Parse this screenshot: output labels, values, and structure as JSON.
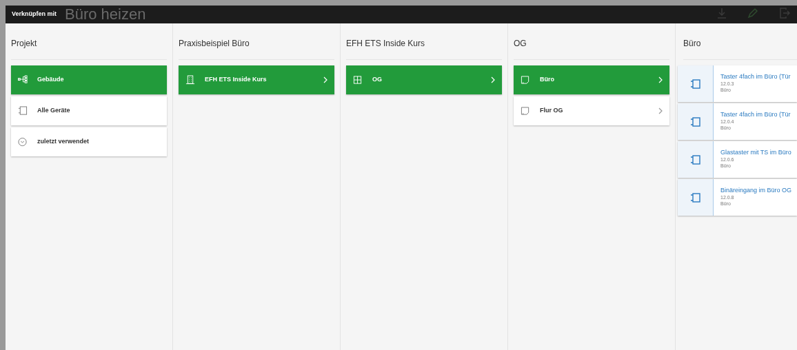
{
  "background": {
    "title": "Büro heizen"
  },
  "dialog": {
    "title": "Verknüpfen mit"
  },
  "columns": [
    {
      "title": "Projekt",
      "items": [
        {
          "label": "Gebäude",
          "kind": "tree",
          "selected": true,
          "expandable": false
        },
        {
          "label": "Alle Geräte",
          "kind": "device",
          "selected": false,
          "expandable": false
        },
        {
          "label": "zuletzt verwendet",
          "kind": "clock",
          "selected": false,
          "expandable": false
        }
      ]
    },
    {
      "title": "Praxisbeispiel Büro",
      "items": [
        {
          "label": "EFH ETS Inside Kurs",
          "kind": "building",
          "selected": true,
          "expandable": true
        }
      ]
    },
    {
      "title": "EFH ETS Inside Kurs",
      "items": [
        {
          "label": "OG",
          "kind": "floor",
          "selected": true,
          "expandable": true
        }
      ]
    },
    {
      "title": "OG",
      "items": [
        {
          "label": "Büro",
          "kind": "room",
          "selected": true,
          "expandable": true
        },
        {
          "label": "Flur OG",
          "kind": "room",
          "selected": false,
          "expandable": true
        }
      ]
    }
  ],
  "devices_column": {
    "title": "Büro",
    "devices": [
      {
        "name": "Taster 4fach im Büro (Tür",
        "address": "12.0.3",
        "room": "Büro"
      },
      {
        "name": "Taster 4fach im Büro (Tür",
        "address": "12.0.4",
        "room": "Büro"
      },
      {
        "name": "Glastaster mit TS im Büro",
        "address": "12.0.6",
        "room": "Büro"
      },
      {
        "name": "Binäreingang im Büro OG",
        "address": "12.0.8",
        "room": "Büro"
      }
    ]
  }
}
